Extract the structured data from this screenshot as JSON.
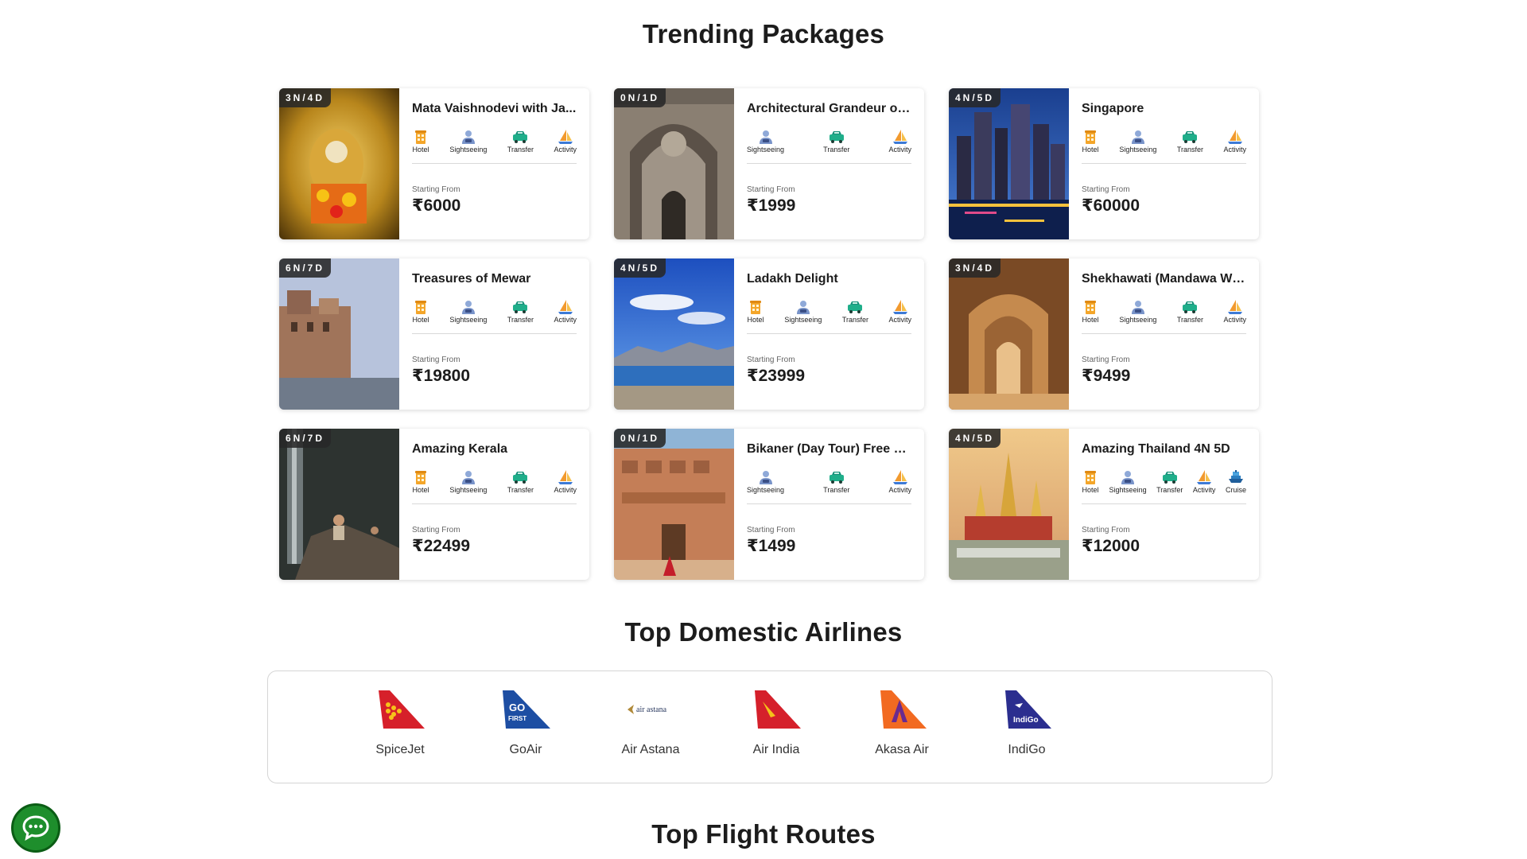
{
  "sections": {
    "trending_title": "Trending Packages",
    "airlines_title": "Top Domestic Airlines",
    "routes_title": "Top Flight Routes"
  },
  "starting_from_label": "Starting From",
  "amenity_labels": {
    "hotel": "Hotel",
    "sightseeing": "Sightseeing",
    "transfer": "Transfer",
    "activity": "Activity",
    "cruise": "Cruise"
  },
  "packages": [
    {
      "duration": "3N/4D",
      "title": "Mata Vaishnodevi with Ja...",
      "price": "₹6000",
      "amenities": [
        "hotel",
        "sightseeing",
        "transfer",
        "activity"
      ],
      "image": "golden-shrine"
    },
    {
      "duration": "0N/1D",
      "title": "Architectural Grandeur of ...",
      "price": "₹1999",
      "amenities": [
        "sightseeing",
        "transfer",
        "activity"
      ],
      "image": "stone-carving"
    },
    {
      "duration": "4N/5D",
      "title": "Singapore",
      "price": "₹60000",
      "amenities": [
        "hotel",
        "sightseeing",
        "transfer",
        "activity"
      ],
      "image": "night-skyline"
    },
    {
      "duration": "6N/7D",
      "title": "Treasures of Mewar",
      "price": "₹19800",
      "amenities": [
        "hotel",
        "sightseeing",
        "transfer",
        "activity"
      ],
      "image": "lakeside-palace"
    },
    {
      "duration": "4N/5D",
      "title": "Ladakh Delight",
      "price": "₹23999",
      "amenities": [
        "hotel",
        "sightseeing",
        "transfer",
        "activity"
      ],
      "image": "blue-lake"
    },
    {
      "duration": "3N/4D",
      "title": "Shekhawati (Mandawa Wit...",
      "price": "₹9499",
      "amenities": [
        "hotel",
        "sightseeing",
        "transfer",
        "activity"
      ],
      "image": "haveli-corridor"
    },
    {
      "duration": "6N/7D",
      "title": "Amazing Kerala",
      "price": "₹22499",
      "amenities": [
        "hotel",
        "sightseeing",
        "transfer",
        "activity"
      ],
      "image": "waterfall-rocks"
    },
    {
      "duration": "0N/1D",
      "title": "Bikaner (Day Tour) Free Ka...",
      "price": "₹1499",
      "amenities": [
        "sightseeing",
        "transfer",
        "activity"
      ],
      "image": "fort-facade"
    },
    {
      "duration": "4N/5D",
      "title": "Amazing Thailand 4N 5D",
      "price": "₹12000",
      "amenities": [
        "hotel",
        "sightseeing",
        "transfer",
        "activity",
        "cruise"
      ],
      "image": "thai-temple"
    }
  ],
  "airlines": [
    {
      "name": "SpiceJet",
      "logo": "spicejet-tail"
    },
    {
      "name": "GoAir",
      "logo": "goair-tail"
    },
    {
      "name": "Air Astana",
      "logo": "air-astana-wordmark",
      "logo_text": "air astana"
    },
    {
      "name": "Air India",
      "logo": "air-india-tail"
    },
    {
      "name": "Akasa Air",
      "logo": "akasa-tail"
    },
    {
      "name": "IndiGo",
      "logo": "indigo-tail",
      "logo_text": "IndiGo"
    }
  ],
  "colors": {
    "spicejet": "#d6202a",
    "goair": "#1d4ea3",
    "airindia": "#d5202b",
    "akasa": "#f26a21",
    "indigo": "#2b2e8f",
    "chat": "#1e8e2c"
  }
}
